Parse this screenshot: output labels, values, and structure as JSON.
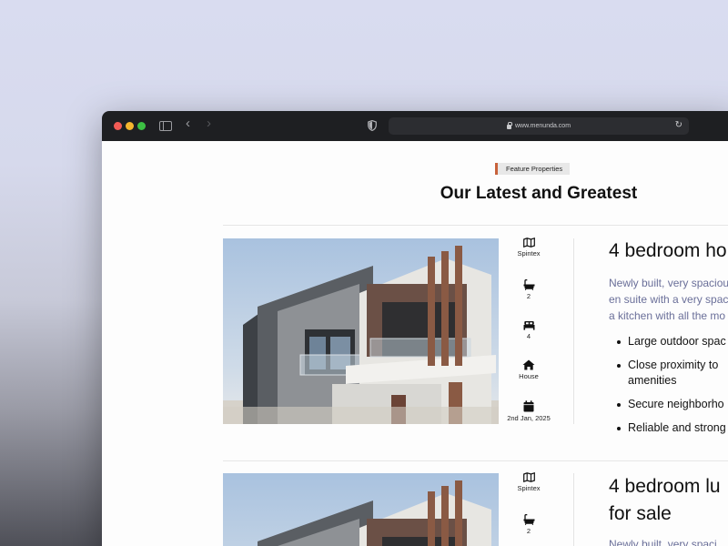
{
  "browser": {
    "url": "www.menunda.com"
  },
  "section": {
    "tag": "Feature Properties",
    "title": "Our Latest and Greatest"
  },
  "listings": [
    {
      "title": "4 bedroom ho",
      "location": "Spintex",
      "bathrooms": "2",
      "bedrooms": "4",
      "type": "House",
      "date": "2nd Jan, 2025",
      "description": [
        "Newly built, very spacious",
        "en suite with a very spac",
        "a kitchen with all the mo"
      ],
      "features": [
        "Large outdoor spac",
        "Close proximity to",
        "amenities",
        "Secure neighborho",
        "Reliable and strong"
      ]
    },
    {
      "title_line1": "4 bedroom lu",
      "title_line2": "for sale",
      "location": "Spintex",
      "bathrooms": "2",
      "description": [
        "Newly built, very spaci"
      ]
    }
  ],
  "colors": {
    "accent": "#c8623b",
    "desc_text": "#6a6f99",
    "titlebar": "#1e1f22"
  }
}
